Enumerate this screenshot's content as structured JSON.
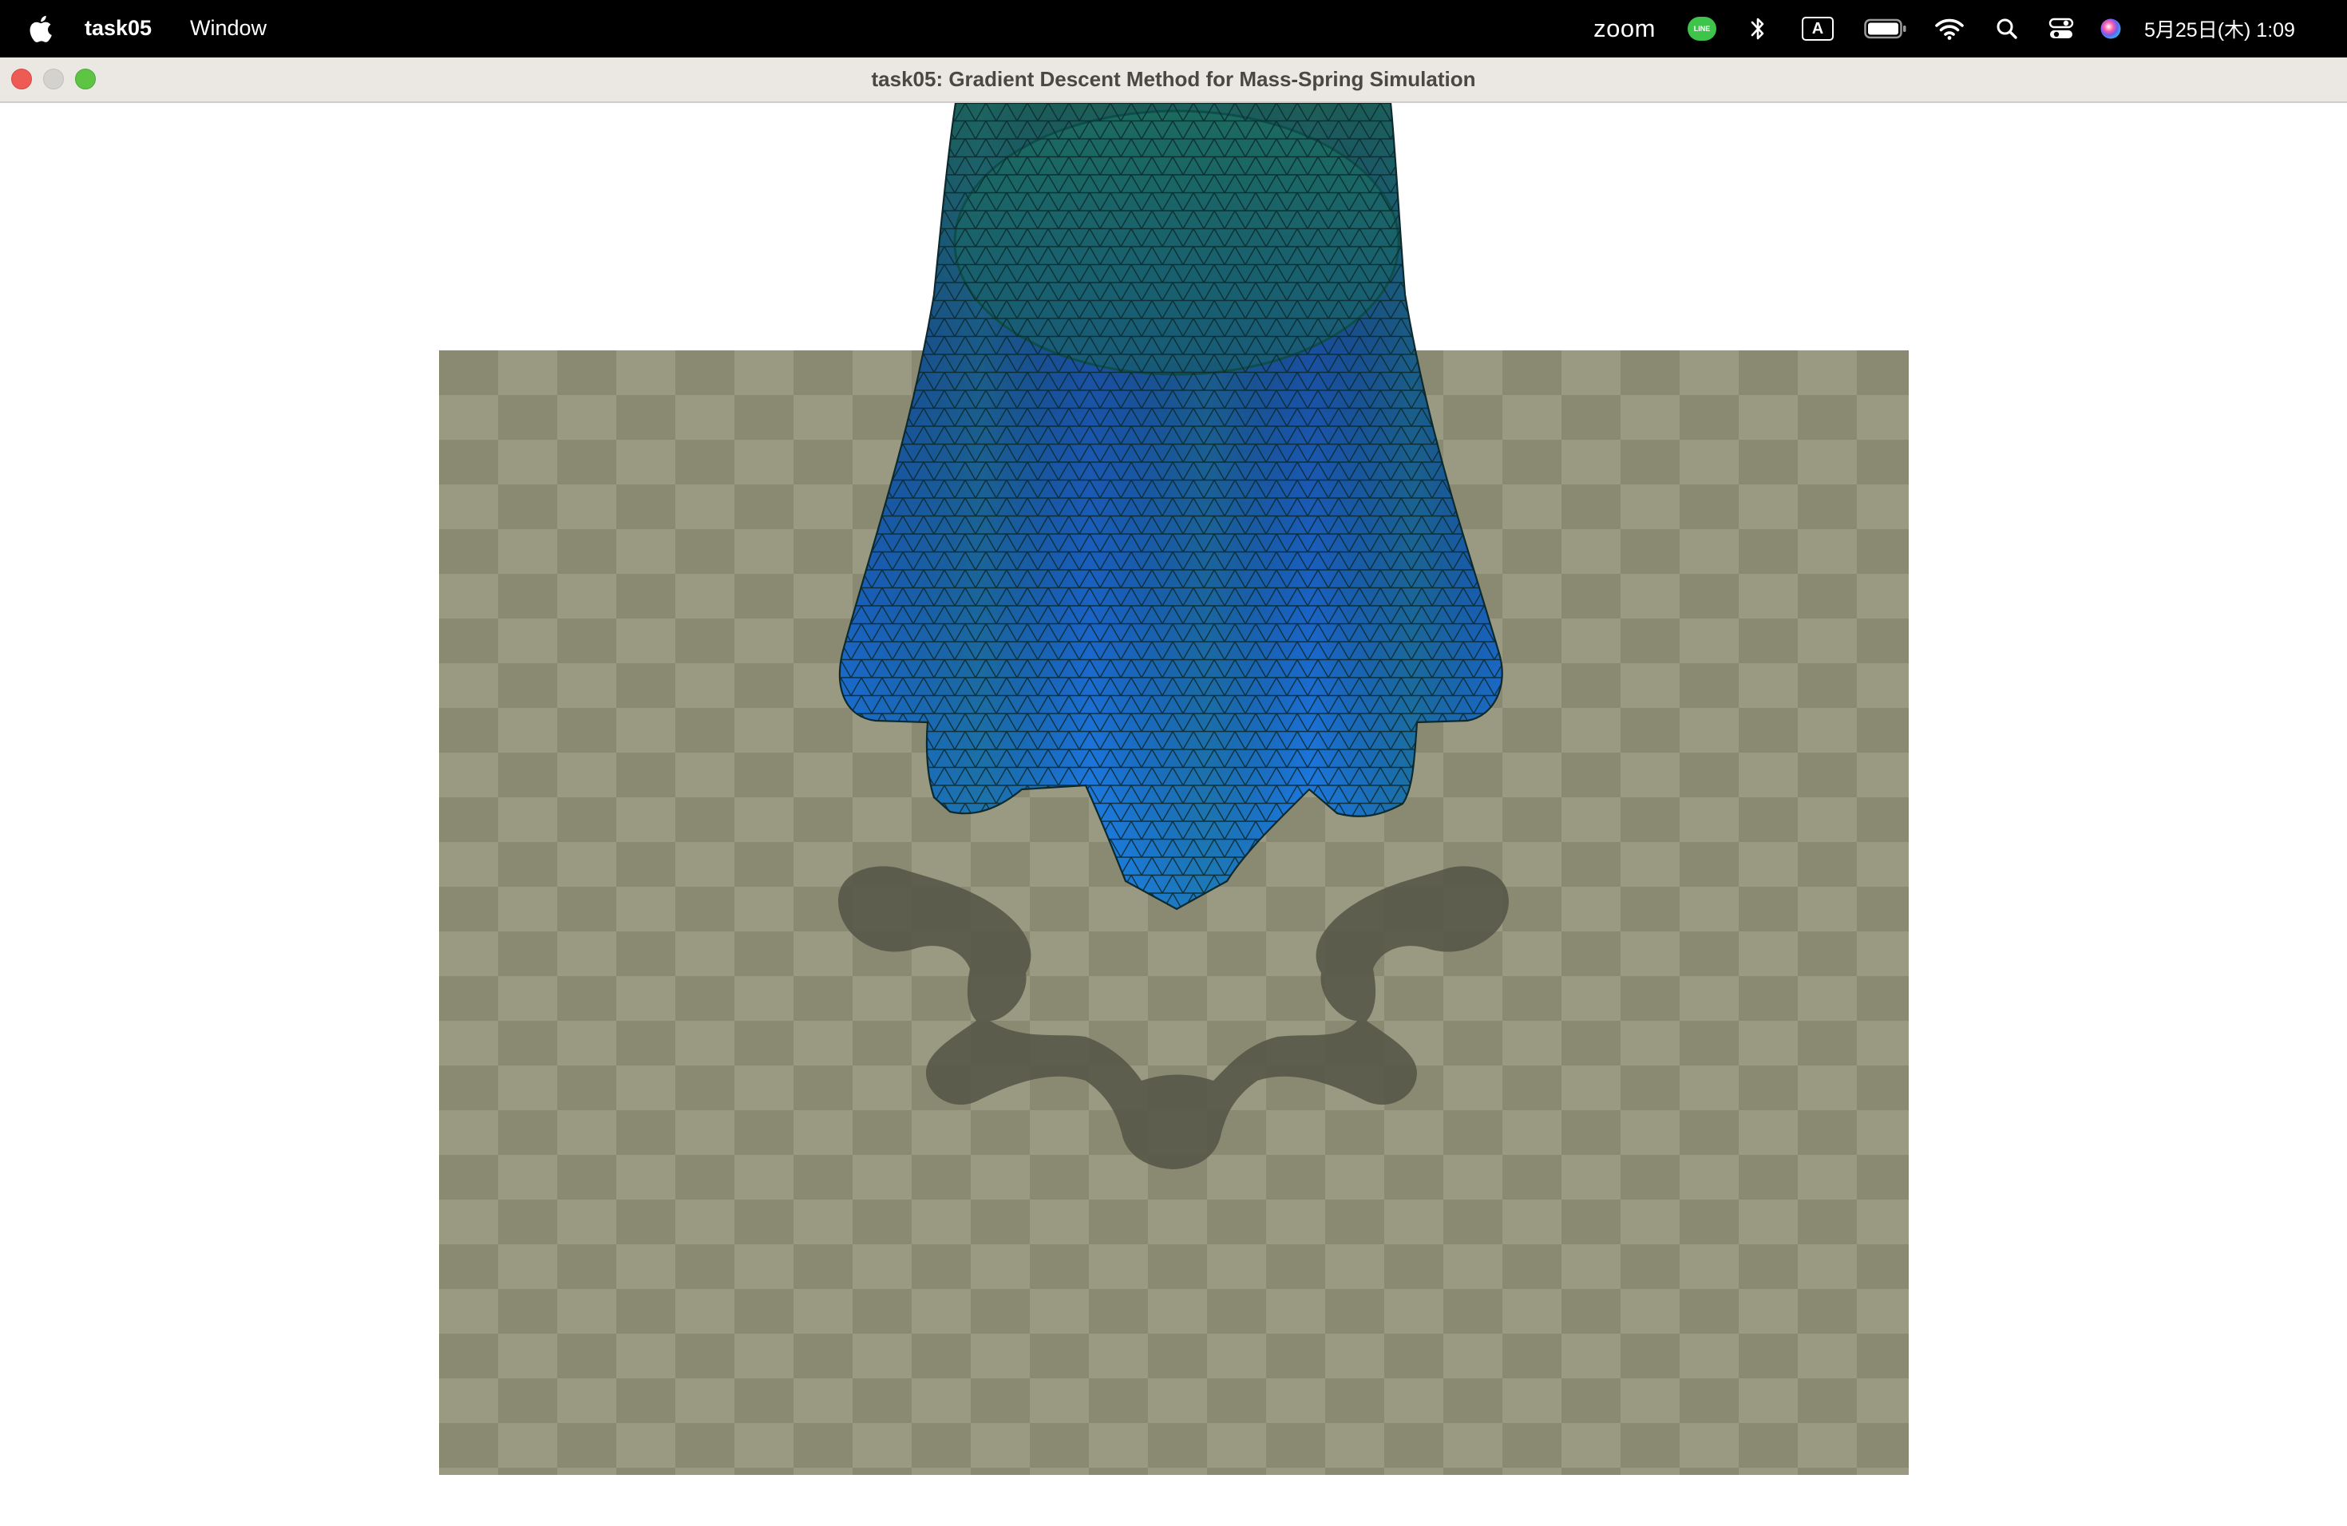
{
  "menubar": {
    "app_name": "task05",
    "items": [
      "Window"
    ],
    "status": {
      "zoom_label": "zoom",
      "line_label": "LINE",
      "input_label": "A",
      "clock": "5月25日(木) 1:09"
    },
    "icons": [
      "apple-icon",
      "line-icon",
      "bluetooth-icon",
      "input-source-icon",
      "battery-icon",
      "wifi-icon",
      "spotlight-search-icon",
      "control-center-icon",
      "siri-icon"
    ]
  },
  "window": {
    "title": "task05: Gradient Descent Method for Mass-Spring Simulation",
    "buttons": [
      "close",
      "minimize",
      "zoom"
    ]
  },
  "scene": {
    "background_color": "#ffffff",
    "floor": {
      "light_color": "#9a9a82",
      "dark_color": "#8a8a72",
      "pattern": "checkerboard"
    },
    "cloth": {
      "top_color": "#1e5f56",
      "mid_color": "#1a55b0",
      "bottom_color": "#1e86ee",
      "edge_color": "#0c2a2e"
    },
    "shadow_color": "#545445"
  }
}
